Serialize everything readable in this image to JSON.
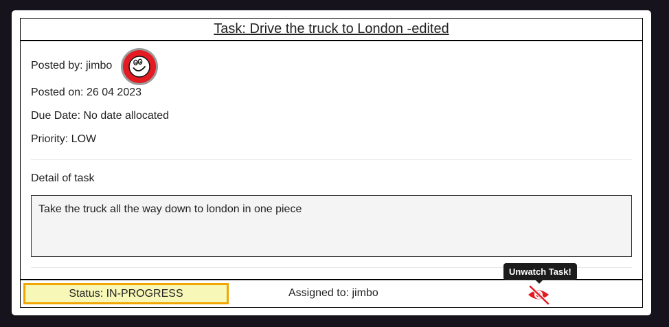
{
  "task": {
    "title": "Task: Drive the truck to London -edited",
    "posted_by": "Posted by: jimbo",
    "posted_on": "Posted on: 26 04 2023",
    "due_date": "Due Date: No date allocated",
    "priority": "Priority: LOW",
    "detail_label": "Detail of task",
    "detail_text": "Take the truck all the way down to london in one piece"
  },
  "footer": {
    "status": "Status: IN-PROGRESS",
    "assigned_to": "Assigned to: jimbo",
    "unwatch_tooltip": "Unwatch Task!",
    "unwatch_icon": "eye-slash-icon"
  },
  "colors": {
    "background": "#16131c",
    "status_fill": "#f7f7b8",
    "status_border": "#f0a500",
    "avatar_red": "#e41b23",
    "unwatch_red": "#e41b23"
  }
}
